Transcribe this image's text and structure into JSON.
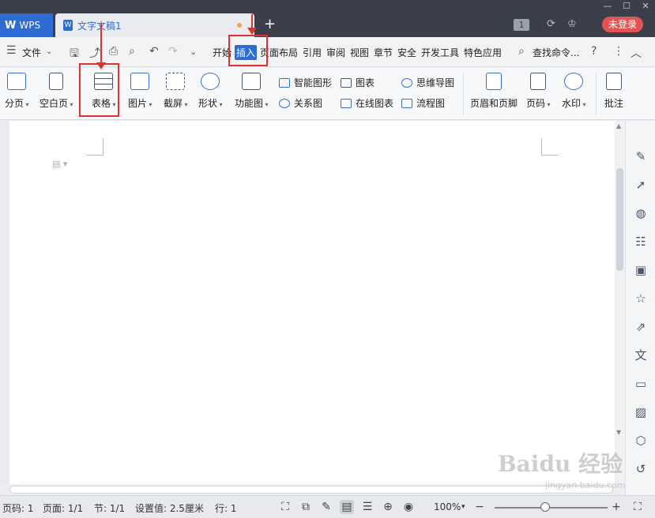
{
  "titlebar": {
    "app_label": "WPS",
    "doc_tab_label": "文字文稿1",
    "new_tab": "+",
    "badge": "1",
    "login_label": "未登录"
  },
  "menubar": {
    "file_label": "文件",
    "tabs": [
      "开始",
      "插入",
      "页面布局",
      "引用",
      "审阅",
      "视图",
      "章节",
      "安全",
      "开发工具",
      "特色应用"
    ],
    "active_tab": "插入",
    "search_label": "查找命令...",
    "help": "?",
    "more": "⋮"
  },
  "ribbon": {
    "page_break": "分页",
    "blank_page": "空白页",
    "table": "表格",
    "picture": "图片",
    "screenshot": "截屏",
    "shapes": "形状",
    "function_chart": "功能图",
    "smart_art": "智能图形",
    "chart": "图表",
    "mind_map": "思维导图",
    "relation_chart": "关系图",
    "online_chart": "在线图表",
    "flowchart": "流程图",
    "header_footer": "页眉和页脚",
    "page_number": "页码",
    "watermark": "水印",
    "comment": "批注"
  },
  "statusbar": {
    "page_num": "页码: 1",
    "pages": "页面: 1/1",
    "section": "节: 1/1",
    "setting": "设置值: 2.5厘米",
    "row": "行: 1",
    "zoom": "100%",
    "zoom_level": 0.45
  },
  "watermark": {
    "brand": "Baidu 经验",
    "url": "jingyan.baidu.com"
  },
  "colors": {
    "accent": "#2e6bd3",
    "titlebar": "#3a3f4b",
    "login": "#e05553",
    "annotation": "#e03030"
  }
}
